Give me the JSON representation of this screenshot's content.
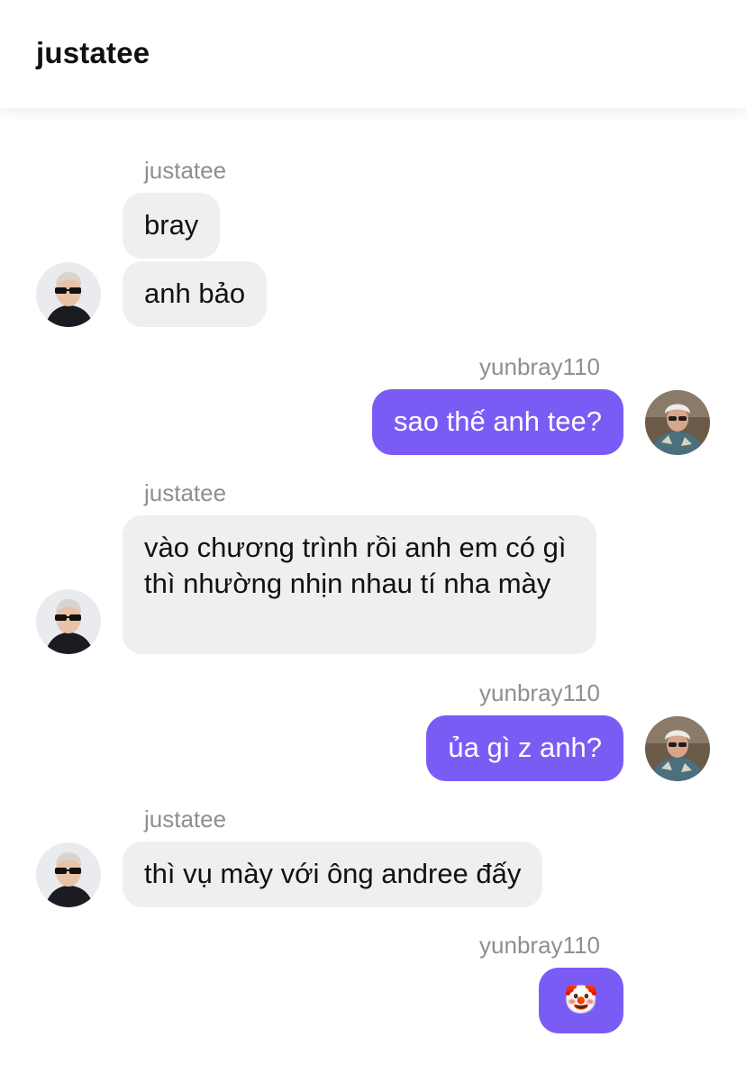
{
  "header": {
    "title": "justatee"
  },
  "messages": [
    {
      "sender": "justatee"
    },
    {
      "text": "bray"
    },
    {
      "text": "anh bảo"
    },
    {
      "sender": "yunbray110"
    },
    {
      "text": "sao thế anh tee?"
    },
    {
      "sender": "justatee"
    },
    {
      "text": "vào chương trình rồi anh em có gì thì nhường nhịn nhau tí nha mày"
    },
    {
      "sender": "yunbray110"
    },
    {
      "text": "ủa gì z anh?"
    },
    {
      "sender": "justatee"
    },
    {
      "text": "thì vụ mày với ông andree đấy"
    },
    {
      "sender": "yunbray110"
    },
    {
      "text": "🤡"
    }
  ],
  "colors": {
    "incoming_bubble": "#efeff2",
    "outgoing_bubble": "#7a5cf5",
    "sender_label": "#8e8e93"
  },
  "icons": {
    "justatee_avatar": "avatar-justatee-icon",
    "yunbray_avatar": "avatar-yunbray-icon"
  }
}
